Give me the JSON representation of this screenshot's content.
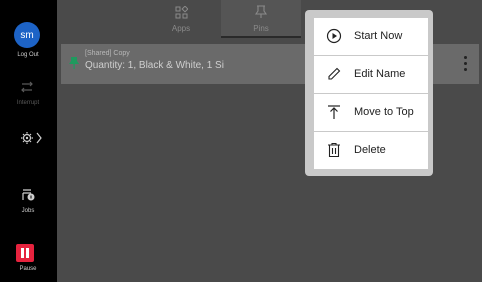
{
  "rail": {
    "avatar_text": "sm",
    "logout_label": "Log Out",
    "interrupt_label": "Interrupt",
    "jobs_label": "Jobs",
    "pause_label": "Pause"
  },
  "tabs": [
    {
      "label": "Apps",
      "icon": "apps-grid-icon"
    },
    {
      "label": "Pins",
      "icon": "pin-icon"
    }
  ],
  "job": {
    "shared": "[Shared] Copy",
    "description": "Quantity: 1, Black & White, 1 Si"
  },
  "menu": {
    "items": [
      {
        "label": "Start Now",
        "icon": "play-circle-icon"
      },
      {
        "label": "Edit Name",
        "icon": "pencil-icon"
      },
      {
        "label": "Move to Top",
        "icon": "move-to-top-icon"
      },
      {
        "label": "Delete",
        "icon": "trash-icon"
      }
    ]
  },
  "colors": {
    "accent": "#1d63c6",
    "pause": "#e6233e",
    "pin": "#1f9a5e"
  }
}
